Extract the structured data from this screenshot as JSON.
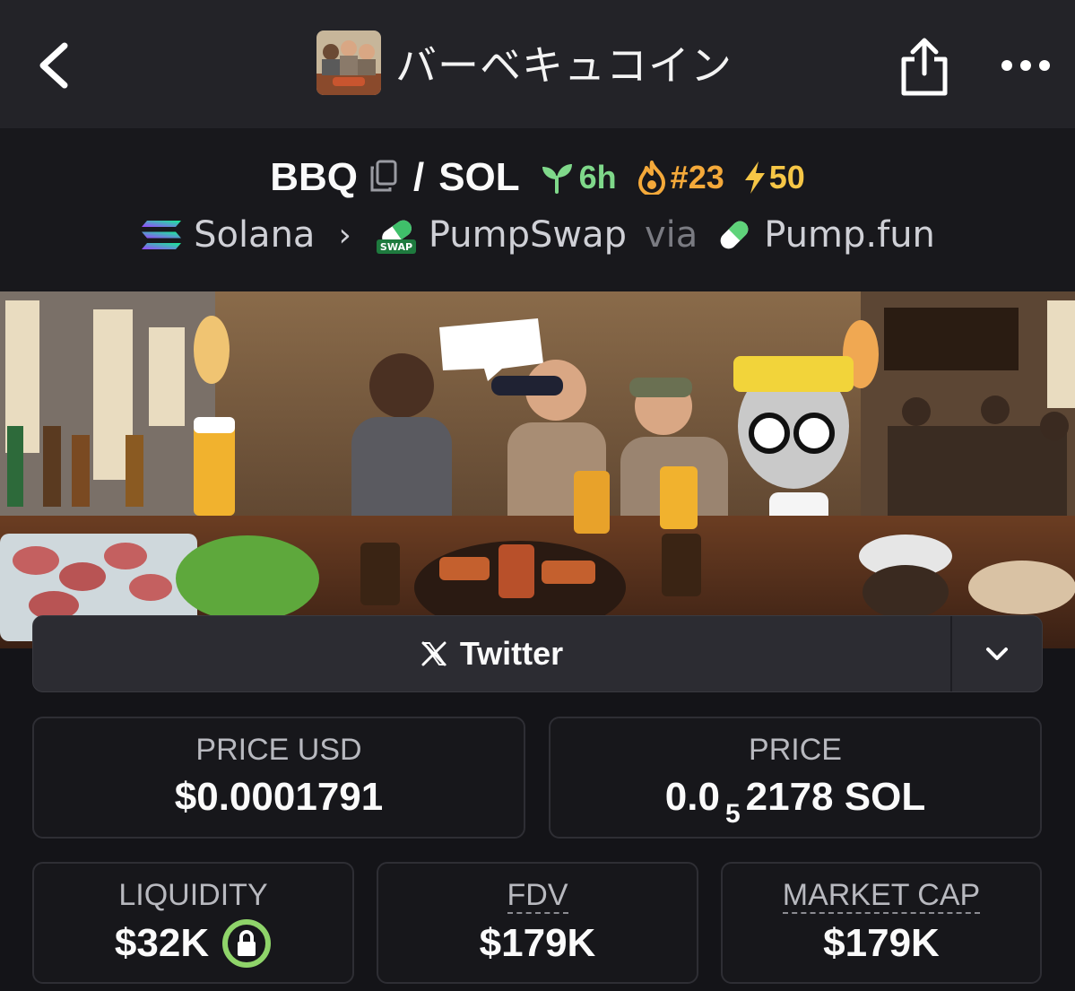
{
  "header": {
    "title": "バーベキュコイン",
    "back_icon": "chevron-left-icon",
    "share_icon": "share-icon",
    "more_icon": "more-horizontal-icon"
  },
  "pair": {
    "base": "BBQ",
    "separator": "/",
    "quote": "SOL",
    "age": "6h",
    "rank": "#23",
    "boost": "50"
  },
  "chain": {
    "network": "Solana",
    "dex": "PumpSwap",
    "via": "via",
    "launchpad": "Pump.fun"
  },
  "social": {
    "twitter_label": "Twitter"
  },
  "stats": {
    "price_usd_label": "PRICE USD",
    "price_usd_value": "$0.0001791",
    "price_label": "PRICE",
    "price_prefix": "0.0",
    "price_subscript": "5",
    "price_suffix": "2178 SOL",
    "liquidity_label": "LIQUIDITY",
    "liquidity_value": "$32K",
    "fdv_label": "FDV",
    "fdv_value": "$179K",
    "mcap_label": "MARKET CAP",
    "mcap_value": "$179K"
  },
  "colors": {
    "age": "#7fd88a",
    "rank": "#f4a93a",
    "boost": "#f6c646",
    "lock": "#8fd46a"
  }
}
